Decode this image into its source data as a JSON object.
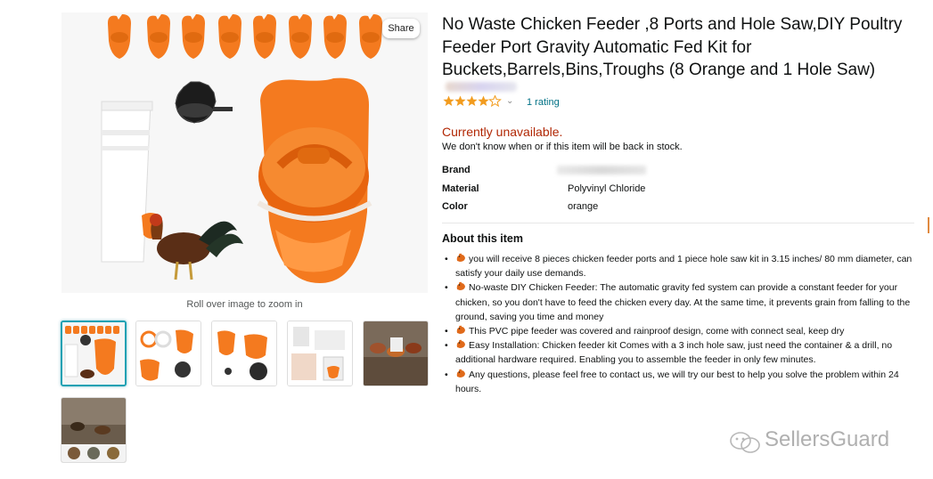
{
  "gallery": {
    "share_label": "Share",
    "zoom_hint": "Roll over image to zoom in",
    "thumbnail_count": 6
  },
  "product": {
    "title": "No Waste Chicken Feeder ,8 Ports and Hole Saw,DIY Poultry Feeder Port Gravity Automatic Fed Kit for Buckets,Barrels,Bins,Troughs (8 Orange and 1 Hole Saw)",
    "rating_value": 4,
    "rating_link": "1 rating",
    "availability": "Currently unavailable.",
    "stock_message": "We don't know when or if this item will be back in stock.",
    "specs": [
      {
        "label": "Brand",
        "value": ""
      },
      {
        "label": "Material",
        "value": "Polyvinyl Chloride"
      },
      {
        "label": "Color",
        "value": "orange"
      }
    ]
  },
  "about": {
    "heading": "About this item",
    "bullets": [
      "you will receive 8 pieces chicken feeder ports and 1 piece hole saw kit in 3.15 inches/ 80 mm diameter, can satisfy your daily use demands.",
      "No-waste DIY Chicken Feeder: The automatic gravity fed system can provide a constant feeder for your chicken, so you don't have to feed the chicken every day. At the same time, it prevents grain from falling to the ground, saving you time and money",
      "This PVC pipe feeder was covered and rainproof design, come with connect seal, keep dry",
      "Easy Installation: Chicken feeder kit Comes with a 3 inch hole saw, just need the container & a drill, no additional hardware required. Enabling you to assemble the feeder in only few minutes.",
      "Any questions, please feel free to contact us, we will try our best to help you solve the problem within 24 hours."
    ]
  },
  "watermark": {
    "text": "SellersGuard",
    "icon": "wechat-icon"
  },
  "colors": {
    "accent_orange": "#f47a1f",
    "unavailable_red": "#b12704",
    "link_teal": "#007185",
    "star_orange": "#f29c1f"
  }
}
